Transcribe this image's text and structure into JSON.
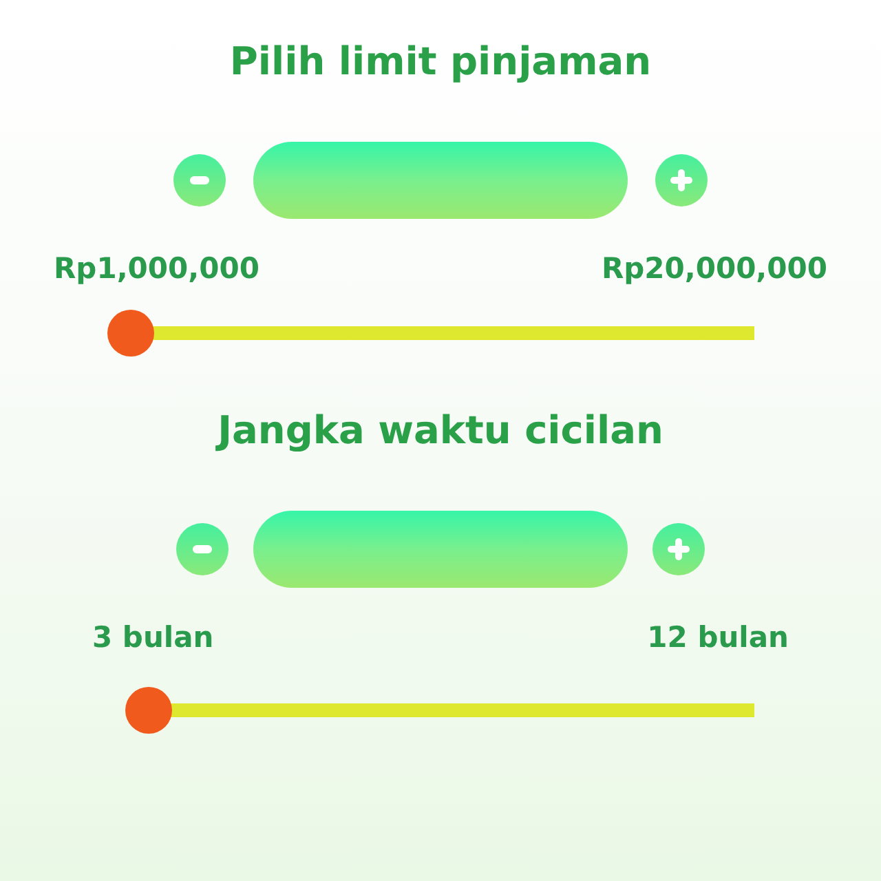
{
  "sections": [
    {
      "title": "Pilih limit pinjaman",
      "min_label": "Rp1,000,000",
      "max_label": "Rp20,000,000",
      "level": 0
    },
    {
      "title": "Jangka waktu cicilan",
      "min_label": "3 bulan",
      "max_label": "12 bulan",
      "level": 0
    }
  ]
}
